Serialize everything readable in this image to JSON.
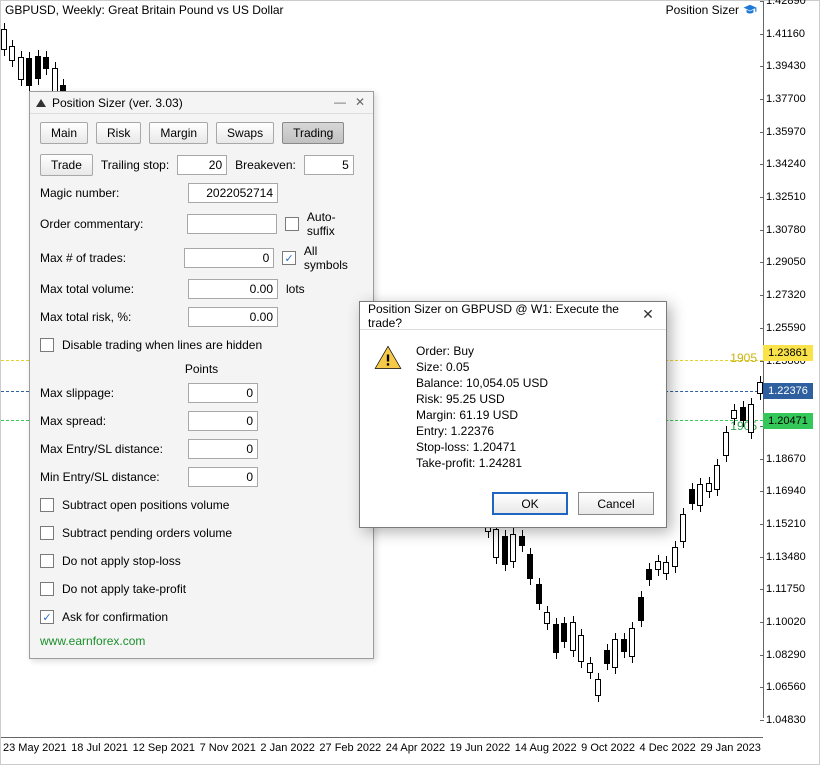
{
  "chart": {
    "title": "GBPUSD, Weekly:  Great Britain Pound vs US Dollar",
    "indicator_label": "Position Sizer",
    "y_ticks": [
      "1.42890",
      "1.41160",
      "1.39430",
      "1.37700",
      "1.35970",
      "1.34240",
      "1.32510",
      "1.30780",
      "1.29050",
      "1.27320",
      "1.25590",
      "1.23860",
      "1.22376",
      "1.20471",
      "1.18670",
      "1.16940",
      "1.15210",
      "1.13480",
      "1.11750",
      "1.10020",
      "1.08290",
      "1.06560",
      "1.04830"
    ],
    "x_ticks": [
      "23 May 2021",
      "18 Jul 2021",
      "12 Sep 2021",
      "7 Nov 2021",
      "2 Jan 2022",
      "27 Feb 2022",
      "24 Apr 2022",
      "19 Jun 2022",
      "14 Aug 2022",
      "9 Oct 2022",
      "4 Dec 2022",
      "29 Jan 2023"
    ],
    "price_tags": {
      "yellow": "1.23861",
      "blue": "1.22376",
      "green": "1.20471"
    },
    "side_numbers": {
      "yellow": "1905",
      "green": "1905"
    }
  },
  "panel": {
    "title": "Position Sizer (ver. 3.03)",
    "tabs": {
      "main": "Main",
      "risk": "Risk",
      "margin": "Margin",
      "swaps": "Swaps",
      "trading": "Trading"
    },
    "trading": {
      "trade_btn": "Trade",
      "trailing_label": "Trailing stop:",
      "trailing_value": "20",
      "breakeven_label": "Breakeven:",
      "breakeven_value": "5",
      "magic_label": "Magic number:",
      "magic_value": "2022052714",
      "commentary_label": "Order commentary:",
      "commentary_value": "",
      "autosuffix_label": "Auto-suffix",
      "maxtrades_label": "Max # of trades:",
      "maxtrades_value": "0",
      "allsymbols_label": "All symbols",
      "maxvol_label": "Max total volume:",
      "maxvol_value": "0.00",
      "lots_label": "lots",
      "maxrisk_label": "Max total risk, %:",
      "maxrisk_value": "0.00",
      "disable_label": "Disable trading when lines are hidden",
      "points_header": "Points",
      "maxslip_label": "Max slippage:",
      "maxslip_value": "0",
      "maxspread_label": "Max spread:",
      "maxspread_value": "0",
      "maxentry_label": "Max Entry/SL distance:",
      "maxentry_value": "0",
      "minentry_label": "Min Entry/SL distance:",
      "minentry_value": "0",
      "sub_open_label": "Subtract open positions volume",
      "sub_pend_label": "Subtract pending orders volume",
      "no_sl_label": "Do not apply stop-loss",
      "no_tp_label": "Do not apply take-profit",
      "ask_conf_label": "Ask for confirmation",
      "url": "www.earnforex.com"
    }
  },
  "dialog": {
    "title": "Position Sizer on GBPUSD @ W1: Execute the trade?",
    "lines": {
      "order": "Order: Buy",
      "size": "Size: 0.05",
      "balance": "Balance: 10,054.05 USD",
      "risk": "Risk: 95.25 USD",
      "margin": "Margin: 61.19 USD",
      "entry": "Entry: 1.22376",
      "sl": "Stop-loss: 1.20471",
      "tp": "Take-profit: 1.24281"
    },
    "ok": "OK",
    "cancel": "Cancel"
  }
}
